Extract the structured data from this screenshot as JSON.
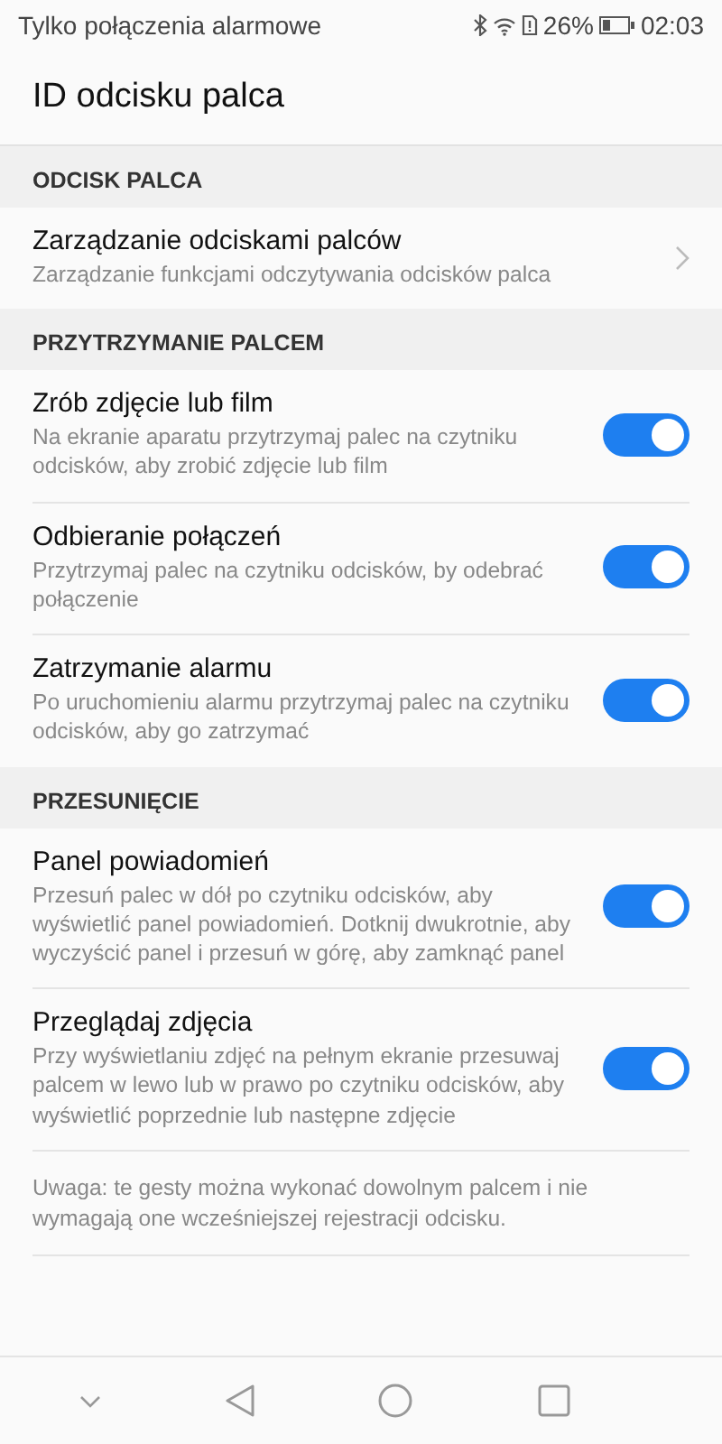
{
  "status_bar": {
    "carrier": "Tylko połączenia alarmowe",
    "battery_percent": "26%",
    "time": "02:03"
  },
  "title": "ID odcisku palca",
  "sections": [
    {
      "header": "ODCISK PALCA",
      "items": [
        {
          "kind": "link",
          "title": "Zarządzanie odciskami palców",
          "subtitle": "Zarządzanie funkcjami odczytywania odcisków palca"
        }
      ]
    },
    {
      "header": "PRZYTRZYMANIE PALCEM",
      "items": [
        {
          "kind": "toggle",
          "title": "Zrób zdjęcie lub film",
          "subtitle": "Na ekranie aparatu przytrzymaj palec na czytniku odcisków, aby zrobić zdjęcie lub film",
          "on": true
        },
        {
          "kind": "toggle",
          "title": "Odbieranie połączeń",
          "subtitle": "Przytrzymaj palec na czytniku odcisków, by odebrać połączenie",
          "on": true
        },
        {
          "kind": "toggle",
          "title": "Zatrzymanie alarmu",
          "subtitle": "Po uruchomieniu alarmu przytrzymaj palec na czytniku odcisków, aby go zatrzymać",
          "on": true
        }
      ]
    },
    {
      "header": "PRZESUNIĘCIE",
      "items": [
        {
          "kind": "toggle",
          "title": "Panel powiadomień",
          "subtitle": "Przesuń palec w dół po czytniku odcisków, aby wyświetlić panel powiadomień. Dotknij dwukrotnie, aby wyczyścić panel i przesuń w górę, aby zamknąć panel",
          "on": true
        },
        {
          "kind": "toggle",
          "title": "Przeglądaj zdjęcia",
          "subtitle": "Przy wyświetlaniu zdjęć na pełnym ekranie przesuwaj palcem w lewo lub w prawo po czytniku odcisków, aby wyświetlić poprzednie lub następne zdjęcie",
          "on": true
        }
      ]
    }
  ],
  "note": "Uwaga: te gesty można wykonać dowolnym palcem i nie wymagają one wcześniejszej rejestracji odcisku."
}
